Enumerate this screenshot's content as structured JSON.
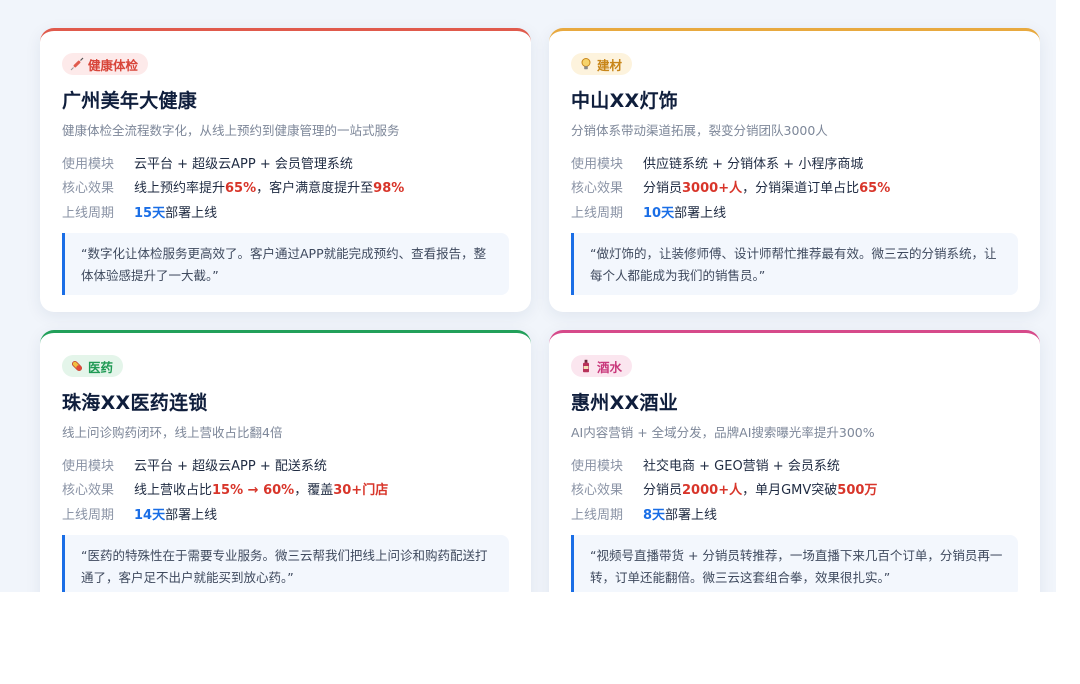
{
  "cards": [
    {
      "tag": "健康体检",
      "tag_icon": "syringe-icon",
      "title": "广州美年大健康",
      "subtitle": "健康体检全流程数字化，从线上预约到健康管理的一站式服务",
      "label_modules": "使用模块",
      "label_effect": "核心效果",
      "label_cycle": "上线周期",
      "modules": "云平台 + 超级云APP + 会员管理系统",
      "effect": [
        "线上预约率提升",
        "65%",
        "，客户满意度提升至",
        "98%"
      ],
      "cycle": [
        "15天",
        "部署上线"
      ],
      "quote": "“数字化让体检服务更高效了。客户通过APP就能完成预约、查看报告，整体体验感提升了一大截。”"
    },
    {
      "tag": "建材",
      "tag_icon": "lightbulb-icon",
      "title": "中山XX灯饰",
      "subtitle": "分销体系带动渠道拓展，裂变分销团队3000人",
      "label_modules": "使用模块",
      "label_effect": "核心效果",
      "label_cycle": "上线周期",
      "modules": "供应链系统 + 分销体系 + 小程序商城",
      "effect": [
        "分销员",
        "3000+人",
        "，分销渠道订单占比",
        "65%"
      ],
      "cycle": [
        "10天",
        "部署上线"
      ],
      "quote": "“做灯饰的，让装修师傅、设计师帮忙推荐最有效。微三云的分销系统，让每个人都能成为我们的销售员。”"
    },
    {
      "tag": "医药",
      "tag_icon": "pill-icon",
      "title": "珠海XX医药连锁",
      "subtitle": "线上问诊购药闭环，线上营收占比翻4倍",
      "label_modules": "使用模块",
      "label_effect": "核心效果",
      "label_cycle": "上线周期",
      "modules": "云平台 + 超级云APP + 配送系统",
      "effect": [
        "线上营收占比",
        "15% → 60%",
        "，覆盖",
        "30+门店"
      ],
      "cycle": [
        "14天",
        "部署上线"
      ],
      "quote": "“医药的特殊性在于需要专业服务。微三云帮我们把线上问诊和购药配送打通了，客户足不出户就能买到放心药。”"
    },
    {
      "tag": "酒水",
      "tag_icon": "wine-bottle-icon",
      "title": "惠州XX酒业",
      "subtitle": "AI内容营销 + 全域分发，品牌AI搜索曝光率提升300%",
      "label_modules": "使用模块",
      "label_effect": "核心效果",
      "label_cycle": "上线周期",
      "modules": "社交电商 + GEO营销 + 会员系统",
      "effect": [
        "分销员",
        "2000+人",
        "，单月GMV突破",
        "500万"
      ],
      "cycle": [
        "8天",
        "部署上线"
      ],
      "quote": "“视频号直播带货 + 分销员转推荐，一场直播下来几百个订单，分销员再一转，订单还能翻倍。微三云这套组合拳，效果很扎实。”"
    }
  ],
  "colors": {
    "accent_blue": "#1a6ee6",
    "highlight_red": "#d8352a",
    "card_top_1": "#e05a4c",
    "card_top_2": "#e8a93f",
    "card_top_3": "#22a05a",
    "card_top_4": "#d64a8a"
  }
}
